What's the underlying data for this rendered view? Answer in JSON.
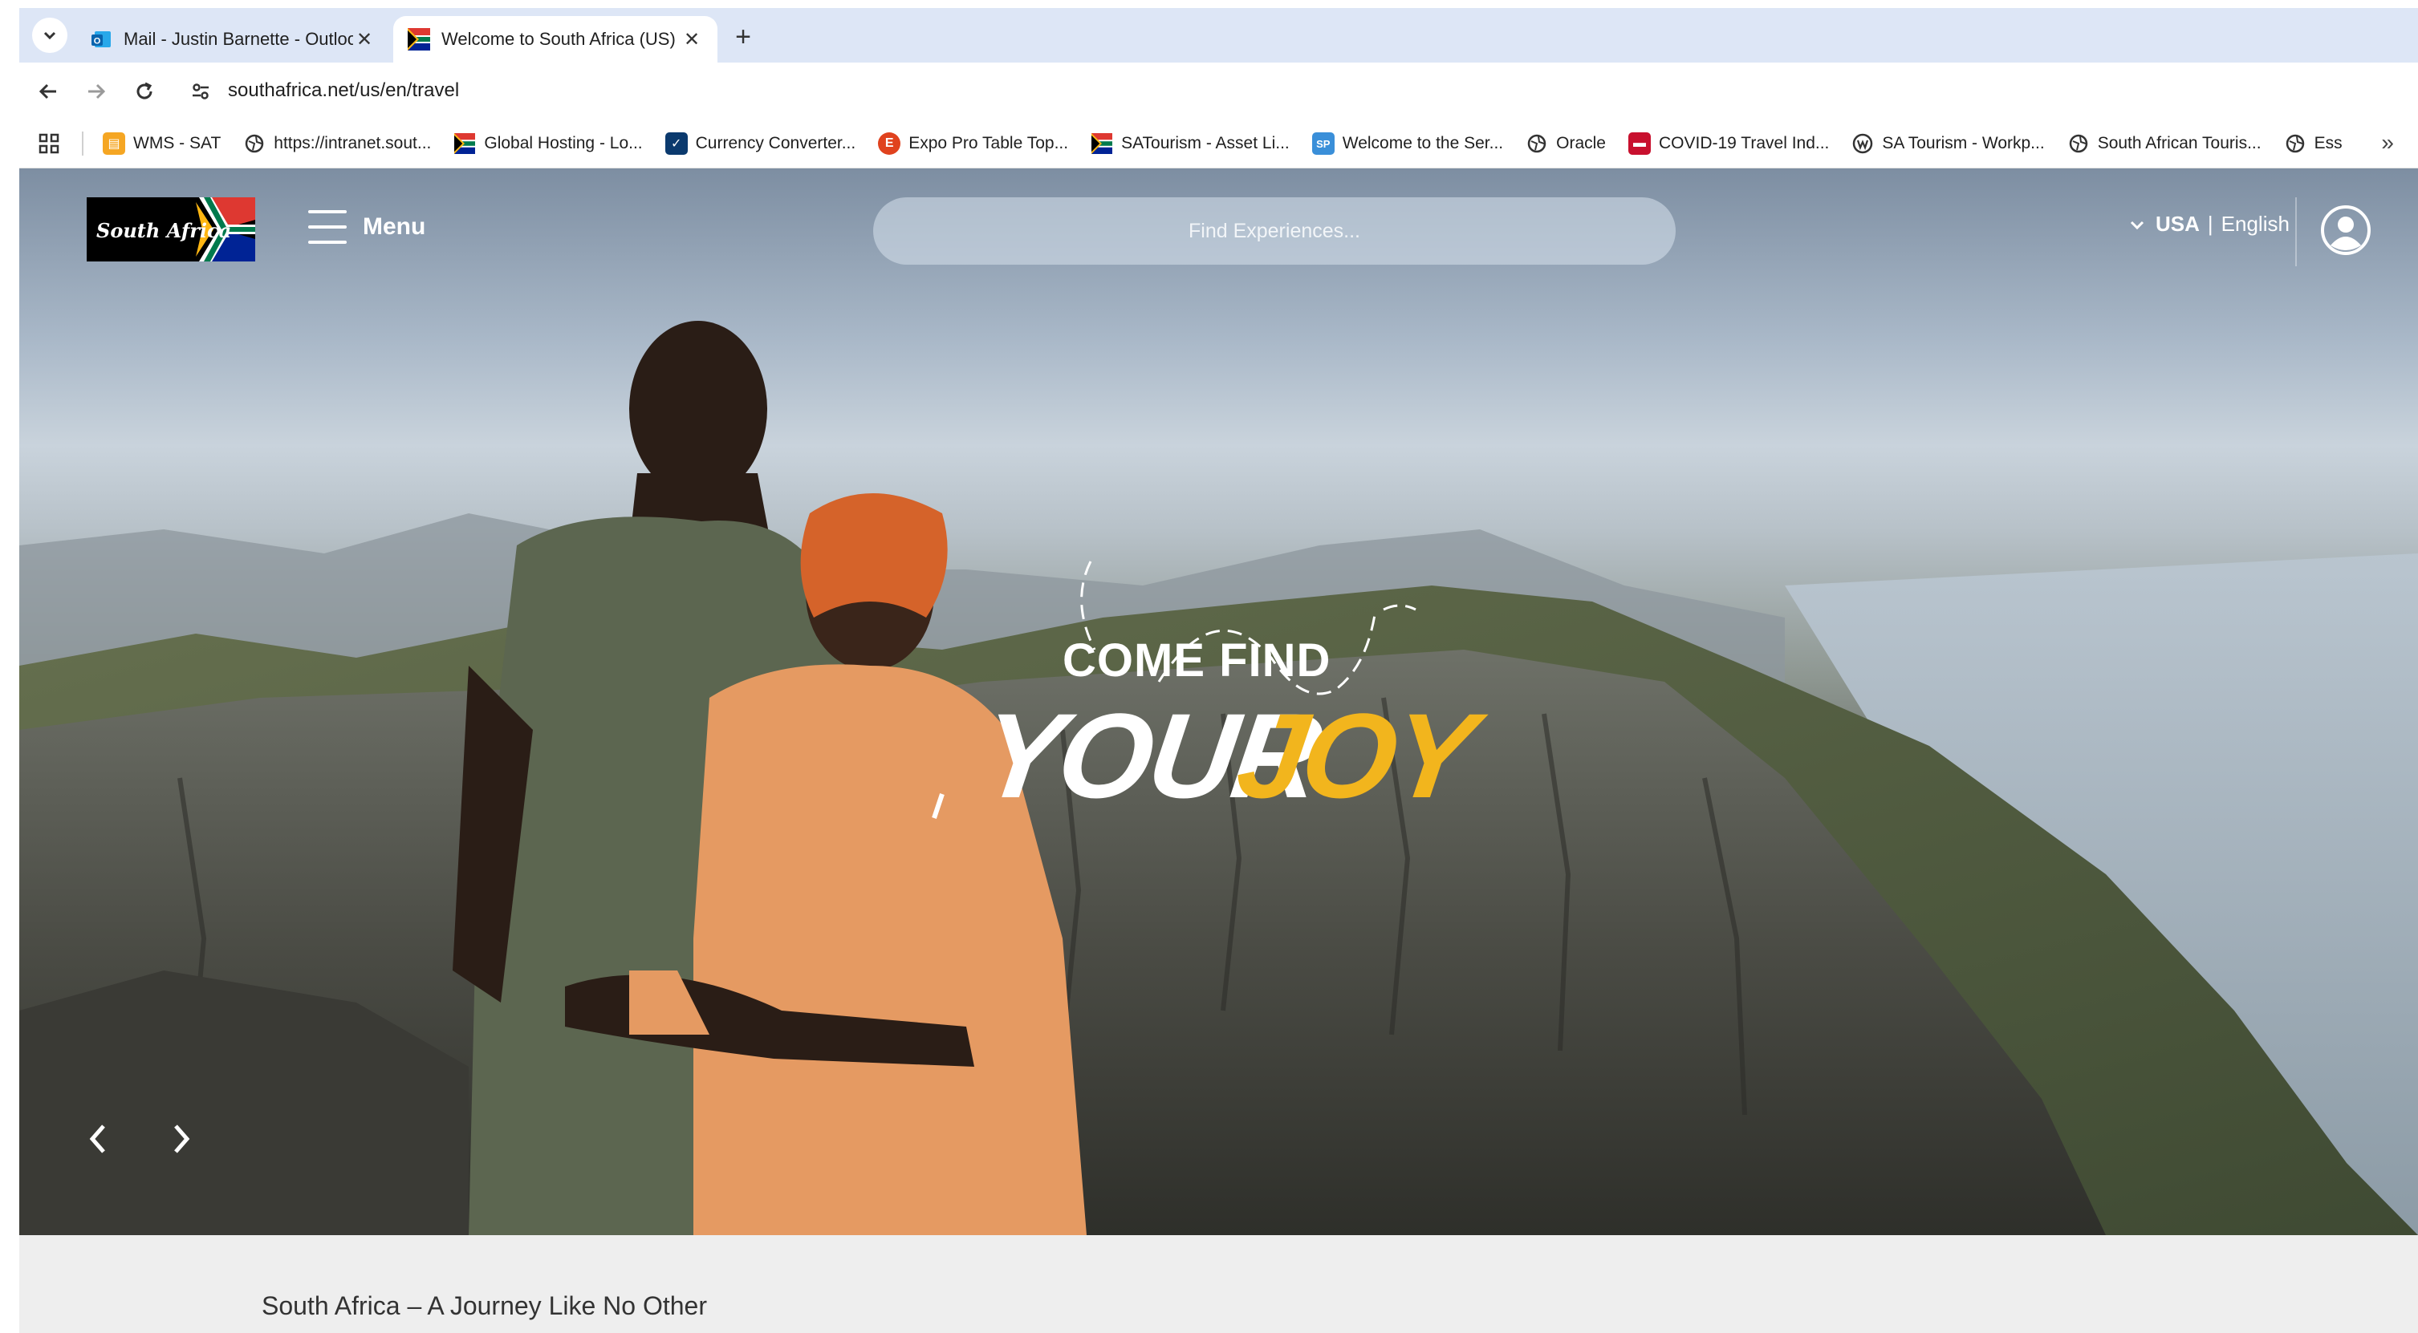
{
  "browser": {
    "tabs": [
      {
        "title": "Mail - Justin Barnette - Outlook",
        "favicon": "outlook-icon",
        "active": false
      },
      {
        "title": "Welcome to South Africa (US)",
        "favicon": "south-africa-flag-icon",
        "active": true
      }
    ],
    "url": "southafrica.net/us/en/travel",
    "bookmarks": [
      {
        "label": "WMS - SAT",
        "icon": "wms-icon"
      },
      {
        "label": "https://intranet.sout...",
        "icon": "globe-icon"
      },
      {
        "label": "Global Hosting - Lo...",
        "icon": "south-africa-flag-icon"
      },
      {
        "label": "Currency Converter...",
        "icon": "currency-icon"
      },
      {
        "label": "Expo Pro Table Top...",
        "icon": "expo-icon"
      },
      {
        "label": "SATourism - Asset Li...",
        "icon": "south-africa-flag-icon"
      },
      {
        "label": "Welcome to the Ser...",
        "icon": "sharepoint-icon"
      },
      {
        "label": "Oracle",
        "icon": "globe-icon"
      },
      {
        "label": "COVID-19 Travel Ind...",
        "icon": "covid-icon"
      },
      {
        "label": "SA Tourism - Workp...",
        "icon": "workplace-icon"
      },
      {
        "label": "South African Touris...",
        "icon": "globe-icon"
      },
      {
        "label": "Ess",
        "icon": "globe-icon"
      }
    ]
  },
  "site": {
    "logo_text": "South Africa",
    "menu_label": "Menu",
    "search_placeholder": "Find Experiences...",
    "locale_country": "USA",
    "locale_separator": "|",
    "locale_language": "English",
    "hero": {
      "headline_top": "COME FIND",
      "headline_word1": "YOUR",
      "headline_word2": "JOY"
    },
    "tagline": "South Africa – A Journey Like No Other"
  },
  "colors": {
    "accent_yellow": "#f2b51d",
    "tabstrip": "#dde6f6",
    "below_fold": "#eeeeee"
  }
}
